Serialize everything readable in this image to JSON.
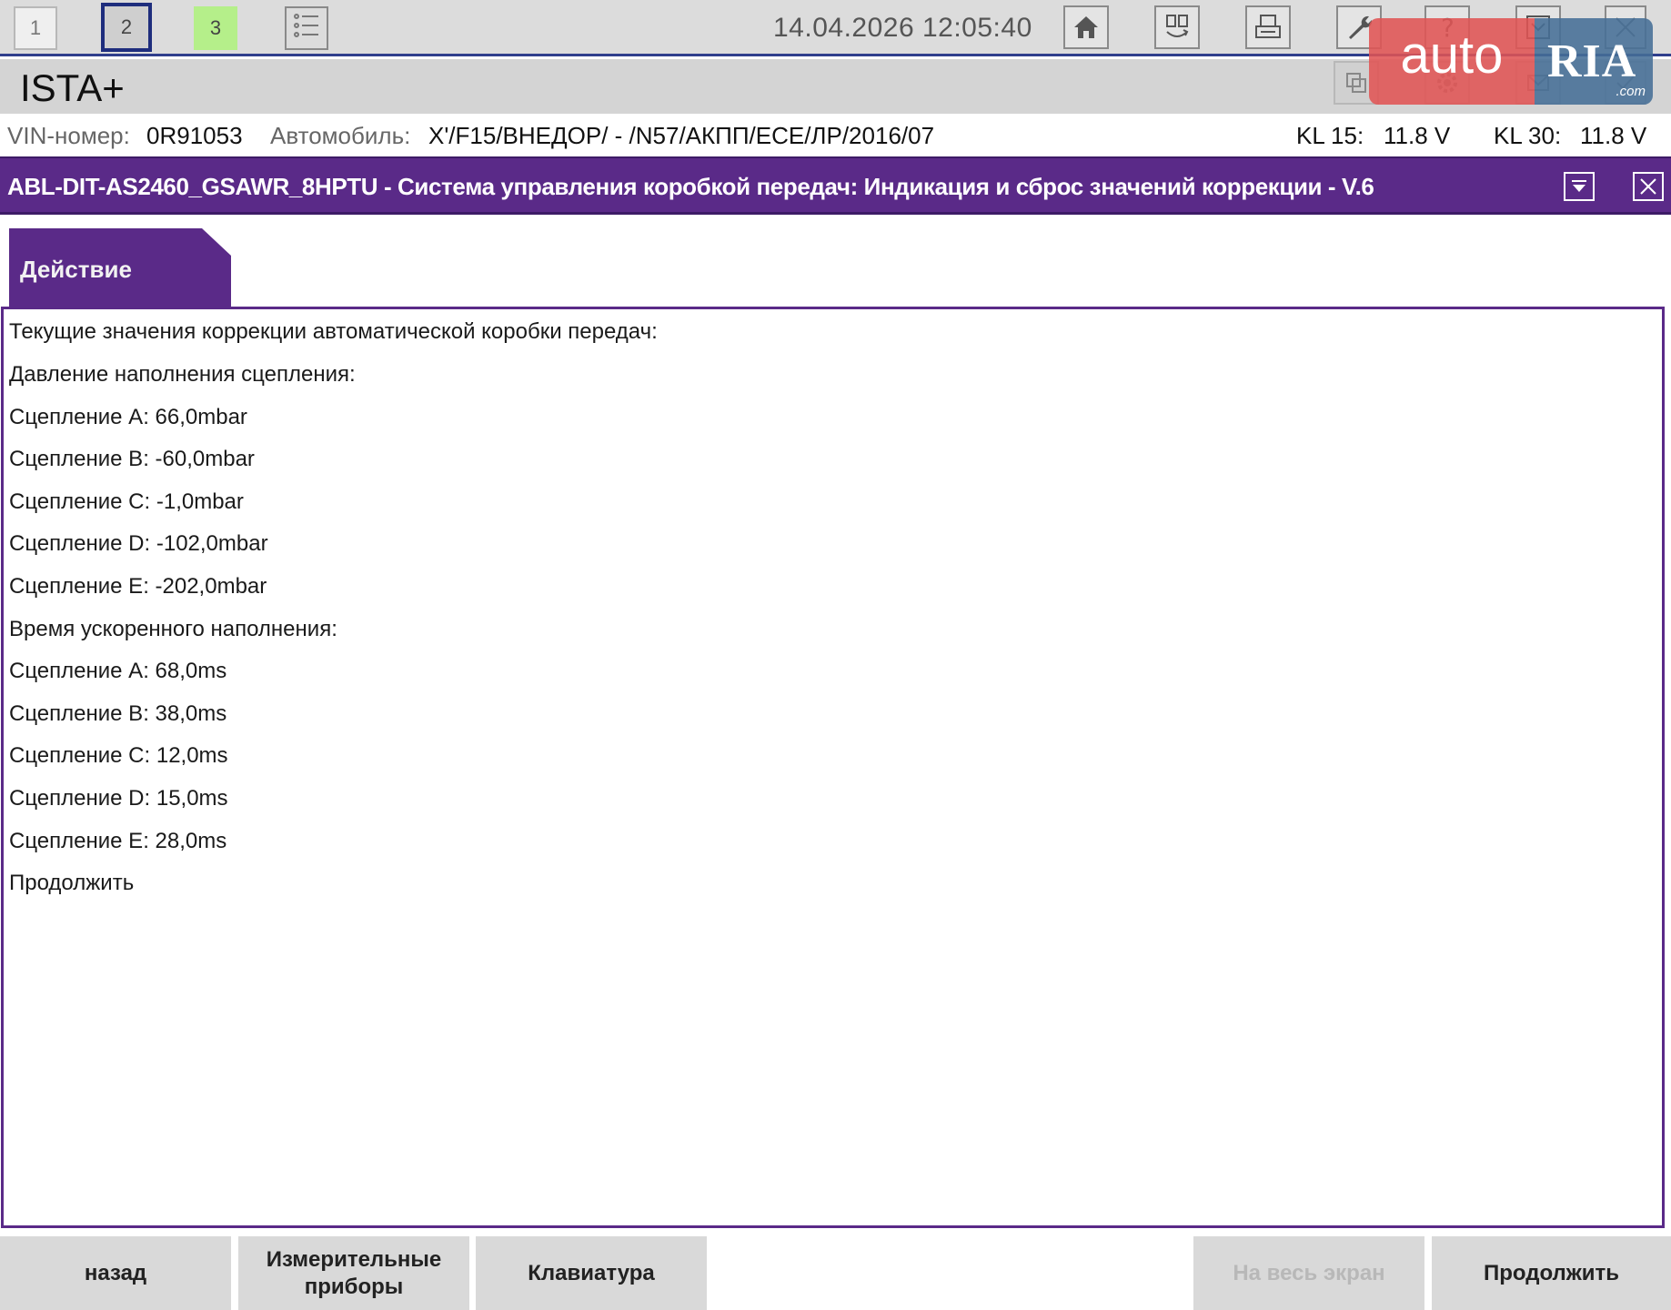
{
  "toolbar": {
    "tabs": [
      "1",
      "2",
      "3"
    ],
    "datetime": "14.04.2026 12:05:40",
    "icons": [
      "list-icon",
      "home-icon",
      "swap-icon",
      "print-icon",
      "wrench-icon",
      "help-icon",
      "collapse-icon",
      "close-icon"
    ]
  },
  "app": {
    "title": "ISTA+"
  },
  "watermark": {
    "part1": "auto",
    "part2": "RIA",
    "suffix": ".com"
  },
  "vehicle": {
    "vin_label": "VIN-номер:",
    "vin_value": "0R91053",
    "car_label": "Автомобиль:",
    "car_value": "X'/F15/ВНЕДОР/ - /N57/АКПП/ЕСЕ/ЛР/2016/07",
    "kl15_label": "KL 15:",
    "kl15_value": "11.8 V",
    "kl30_label": "KL 30:",
    "kl30_value": "11.8 V"
  },
  "procedure": {
    "title": "ABL-DIT-AS2460_GSAWR_8HPTU - Система управления коробкой передач: Индикация и сброс значений коррекции - V.6",
    "tab_label": "Действие"
  },
  "content": {
    "lines": [
      "Текущие значения коррекции автоматической коробки передач:",
      "Давление наполнения сцепления:",
      "Сцепление A: 66,0mbar",
      "Сцепление B: -60,0mbar",
      "Сцепление C: -1,0mbar",
      "Сцепление D: -102,0mbar",
      "Сцепление E: -202,0mbar",
      "Время ускоренного наполнения:",
      "Сцепление A: 68,0ms",
      "Сцепление B: 38,0ms",
      "Сцепление C: 12,0ms",
      "Сцепление D: 15,0ms",
      "Сцепление E: 28,0ms",
      "Продолжить"
    ]
  },
  "buttons": {
    "back": "назад",
    "instruments_line1": "Измерительные",
    "instruments_line2": "приборы",
    "keyboard": "Клавиатура",
    "fullscreen": "На весь экран",
    "continue": "Продолжить"
  },
  "colors": {
    "accent_purple": "#5a2a88",
    "toolbar_blue": "#2f3e8c",
    "tab3_green": "#b5ef8a"
  }
}
